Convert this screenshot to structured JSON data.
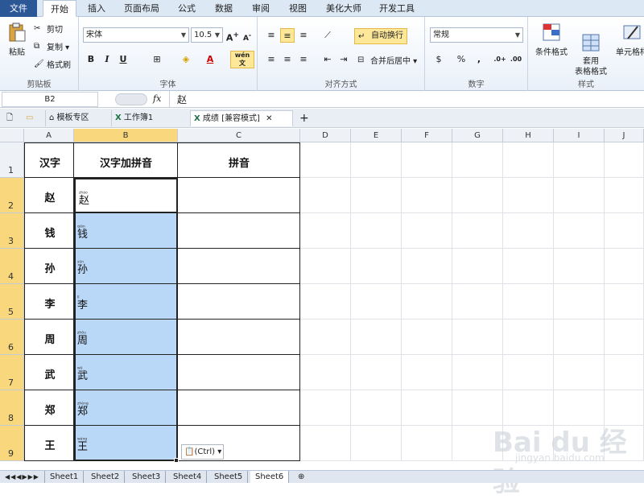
{
  "ribbon_tabs": [
    "文件",
    "开始",
    "插入",
    "页面布局",
    "公式",
    "数据",
    "审阅",
    "视图",
    "美化大师",
    "开发工具"
  ],
  "clipboard": {
    "paste": "粘贴",
    "cut": "剪切",
    "copy": "复制",
    "format_painter": "格式刷",
    "label": "剪贴板"
  },
  "font": {
    "name": "宋体",
    "size": "10.5",
    "label": "字体",
    "bold": "B",
    "italic": "I",
    "underline": "U",
    "wen": "wén 文"
  },
  "alignment": {
    "wrap": "自动换行",
    "merge": "合并后居中",
    "label": "对齐方式"
  },
  "number": {
    "format": "常规",
    "percent": "%",
    "comma": ",",
    "label": "数字"
  },
  "styles": {
    "conditional": "条件格式",
    "table": "套用\n表格格式",
    "cell": "单元格样",
    "label": "样式"
  },
  "formula_bar": {
    "name_box": "B2",
    "fx": "fx",
    "content": "赵"
  },
  "doc_tabs": [
    "模板专区",
    "工作簿1",
    "成绩 [兼容模式]"
  ],
  "columns": [
    "A",
    "B",
    "C",
    "D",
    "E",
    "F",
    "G",
    "H",
    "I",
    "J"
  ],
  "rows": [
    "1",
    "2",
    "3",
    "4",
    "5",
    "6",
    "7",
    "8",
    "9"
  ],
  "headers": {
    "a": "汉字",
    "b": "汉字加拼音",
    "c": "拼音"
  },
  "data": [
    {
      "hanzi": "赵",
      "pinyin": "zhào"
    },
    {
      "hanzi": "钱",
      "pinyin": "qián"
    },
    {
      "hanzi": "孙",
      "pinyin": "sūn"
    },
    {
      "hanzi": "李",
      "pinyin": "lǐ"
    },
    {
      "hanzi": "周",
      "pinyin": "zhōu"
    },
    {
      "hanzi": "武",
      "pinyin": "wǔ"
    },
    {
      "hanzi": "郑",
      "pinyin": "zhèng"
    },
    {
      "hanzi": "王",
      "pinyin": "wáng"
    }
  ],
  "paste_options": "(Ctrl)",
  "sheets": [
    "Sheet1",
    "Sheet2",
    "Sheet3",
    "Sheet4",
    "Sheet5",
    "Sheet6"
  ],
  "active_sheet": "Sheet6",
  "watermark": {
    "main": "Bai du 经验",
    "sub": "jingyan.baidu.com"
  },
  "colors": {
    "accent": "#2b5797",
    "selection": "#b9d7f7",
    "header_sel": "#f8d77d"
  }
}
